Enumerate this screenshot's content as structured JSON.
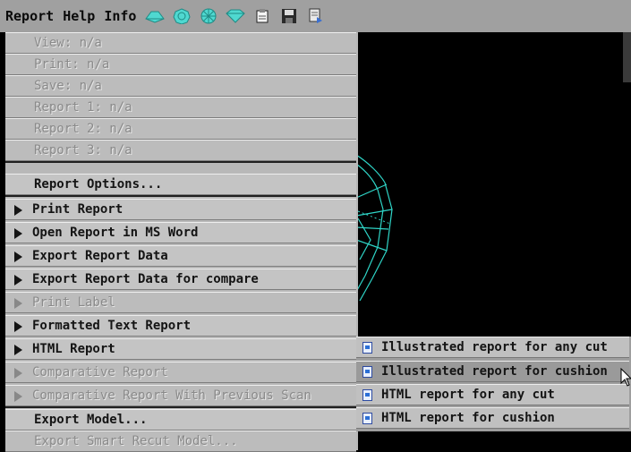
{
  "menubar": {
    "items": [
      "Report",
      "Help",
      "Info"
    ],
    "icons": [
      "diamond-top-icon",
      "round-cut-icon",
      "crosshair-cut-icon",
      "diamond-side-icon",
      "clipboard-icon",
      "save-icon",
      "report-icon"
    ]
  },
  "menu": {
    "view": "View: n/a",
    "print": "Print: n/a",
    "save": "Save: n/a",
    "report1": "Report 1: n/a",
    "report2": "Report 2: n/a",
    "report3": "Report 3: n/a",
    "report_options": "Report Options...",
    "print_report": "Print Report",
    "open_word": "Open Report in MS Word",
    "export_data": "Export Report Data",
    "export_compare": "Export Report Data for compare",
    "print_label": "Print Label",
    "formatted_text": "Formatted Text Report",
    "html_report": "HTML Report",
    "comparative": "Comparative Report",
    "comparative_prev": "Comparative Report With Previous Scan",
    "export_model": "Export Model...",
    "export_smart": "Export Smart Recut Model..."
  },
  "submenu": {
    "items": [
      "Illustrated report for any cut",
      "Illustrated report for cushion",
      "HTML report for any cut",
      "HTML report for cushion"
    ]
  },
  "colors": {
    "wireframe": "#2fd6c8",
    "menu_bg": "#c4c4c4",
    "menubar_bg": "#a0a0a0"
  }
}
